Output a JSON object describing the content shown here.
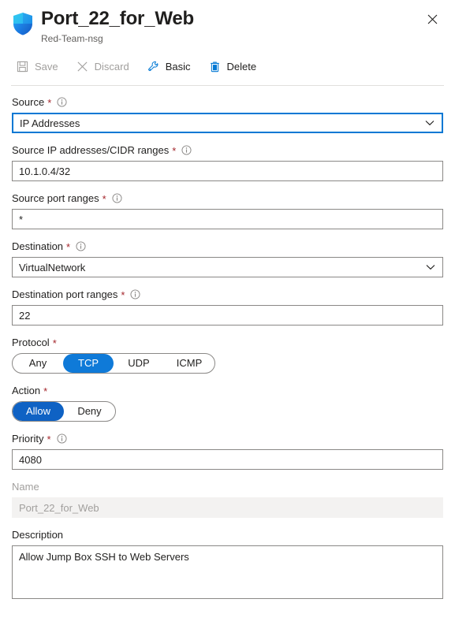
{
  "header": {
    "icon": "shield-icon",
    "title": "Port_22_for_Web",
    "subtitle": "Red-Team-nsg",
    "close_icon": "close-icon"
  },
  "toolbar": {
    "items": [
      {
        "label": "Save",
        "icon": "save-icon",
        "disabled": true
      },
      {
        "label": "Discard",
        "icon": "discard-icon",
        "disabled": true
      },
      {
        "label": "Basic",
        "icon": "wrench-icon",
        "disabled": false
      },
      {
        "label": "Delete",
        "icon": "trash-icon",
        "disabled": false
      }
    ]
  },
  "form": {
    "source": {
      "label": "Source",
      "required": true,
      "info_icon": "info-icon",
      "value": "IP Addresses",
      "focused": true,
      "chevron_icon": "chevron-down-icon"
    },
    "source_ip": {
      "label": "Source IP addresses/CIDR ranges",
      "required": true,
      "info_icon": "info-icon",
      "value": "10.1.0.4/32"
    },
    "source_port": {
      "label": "Source port ranges",
      "required": true,
      "info_icon": "info-icon",
      "value": "*"
    },
    "destination": {
      "label": "Destination",
      "required": true,
      "info_icon": "info-icon",
      "value": "VirtualNetwork",
      "chevron_icon": "chevron-down-icon"
    },
    "destination_port": {
      "label": "Destination port ranges",
      "required": true,
      "info_icon": "info-icon",
      "value": "22"
    },
    "protocol": {
      "label": "Protocol",
      "required": true,
      "options": [
        "Any",
        "TCP",
        "UDP",
        "ICMP"
      ],
      "selected": "TCP"
    },
    "action": {
      "label": "Action",
      "required": true,
      "options": [
        "Allow",
        "Deny"
      ],
      "selected": "Allow"
    },
    "priority": {
      "label": "Priority",
      "required": true,
      "info_icon": "info-icon",
      "value": "4080"
    },
    "name": {
      "label": "Name",
      "required": false,
      "value": "Port_22_for_Web",
      "disabled": true
    },
    "description": {
      "label": "Description",
      "required": false,
      "value": "Allow Jump Box SSH to Web Servers"
    }
  },
  "colors": {
    "accent": "#0078d4",
    "pill_selected": "#0f7ad8",
    "action_selected": "#0f62c4",
    "required_star": "#a4262c",
    "disabled_text": "#a19f9d",
    "border": "#8a8886"
  }
}
